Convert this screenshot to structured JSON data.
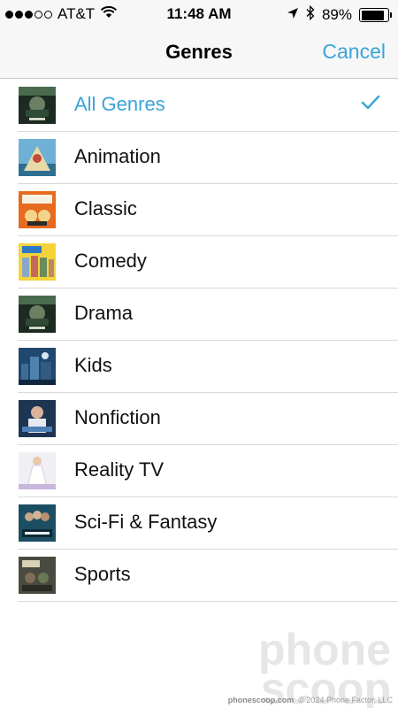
{
  "status_bar": {
    "carrier": "AT&T",
    "time": "11:48 AM",
    "battery": "89%",
    "battery_level": 0.89,
    "signal_bars_filled": 3,
    "signal_bars_total": 5,
    "icons": [
      "wifi-icon",
      "location-arrow-icon",
      "bluetooth-icon",
      "battery-icon"
    ]
  },
  "nav": {
    "title": "Genres",
    "cancel": "Cancel"
  },
  "colors": {
    "accent": "#3aa4d9"
  },
  "genres": [
    {
      "label": "All Genres",
      "selected": true,
      "thumb": "dark-green-poster"
    },
    {
      "label": "Animation",
      "selected": false,
      "thumb": "blue-sky-poster"
    },
    {
      "label": "Classic",
      "selected": false,
      "thumb": "orange-cartoon-poster"
    },
    {
      "label": "Comedy",
      "selected": false,
      "thumb": "yellow-group-poster"
    },
    {
      "label": "Drama",
      "selected": false,
      "thumb": "dark-green-poster"
    },
    {
      "label": "Kids",
      "selected": false,
      "thumb": "blue-city-poster"
    },
    {
      "label": "Nonfiction",
      "selected": false,
      "thumb": "navy-portrait-poster"
    },
    {
      "label": "Reality TV",
      "selected": false,
      "thumb": "white-gown-poster"
    },
    {
      "label": "Sci-Fi & Fantasy",
      "selected": false,
      "thumb": "teal-cast-poster"
    },
    {
      "label": "Sports",
      "selected": false,
      "thumb": "muted-team-poster"
    }
  ],
  "watermark": {
    "logo_line1": "phone",
    "logo_line2": "scoop",
    "site": "phonescoop.com",
    "copyright": "© 2024 Phone Factor, LLC"
  }
}
